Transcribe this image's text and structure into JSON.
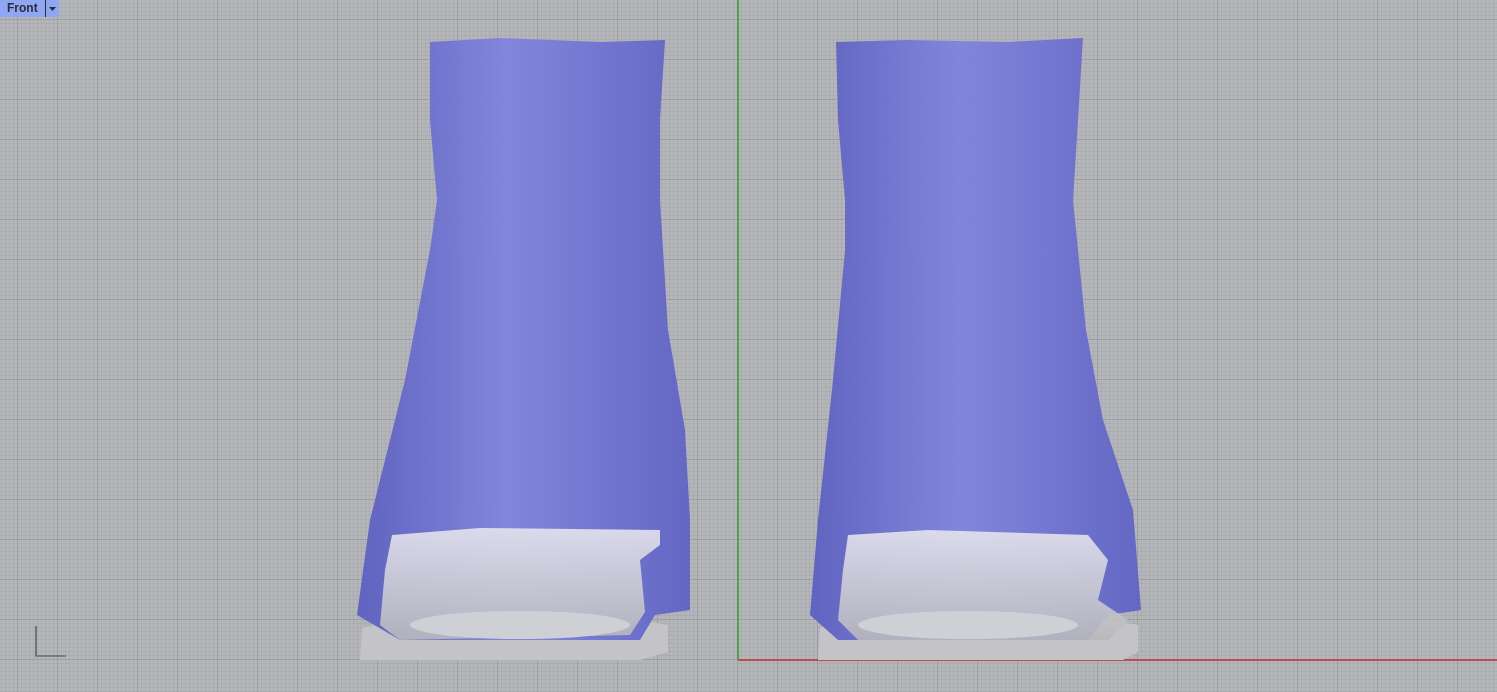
{
  "viewport": {
    "title": "Front"
  }
}
